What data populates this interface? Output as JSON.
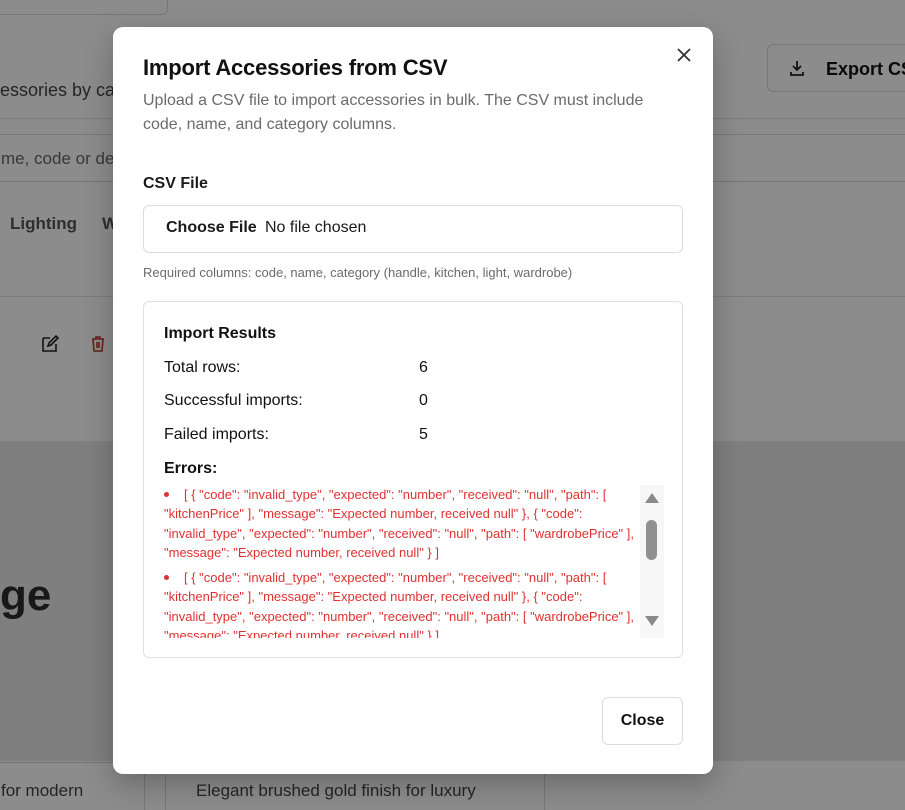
{
  "background": {
    "subtitle": "essories by cate",
    "export_label": "Export CSV",
    "search_placeholder": "me, code or des",
    "tabs": [
      "Lighting",
      "W"
    ],
    "hero_text": "ge",
    "card_left_text": "for modern",
    "card_right_text": "Elegant brushed gold finish for luxury",
    "icons": {
      "edit": "edit-icon",
      "delete": "trash-icon",
      "download": "download-icon"
    }
  },
  "modal": {
    "title": "Import Accessories from CSV",
    "description": "Upload a CSV file to import accessories in bulk. The CSV must include code, name, and category columns.",
    "close_icon": "close-icon",
    "file_field": {
      "label": "CSV File",
      "button_label": "Choose File",
      "status": "No file chosen",
      "hint": "Required columns: code, name, category (handle, kitchen, light, wardrobe)"
    },
    "results": {
      "title": "Import Results",
      "stats": [
        {
          "label": "Total rows:",
          "value": "6"
        },
        {
          "label": "Successful imports:",
          "value": "0"
        },
        {
          "label": "Failed imports:",
          "value": "5"
        }
      ],
      "errors_title": "Errors:",
      "errors": [
        "[ { \"code\": \"invalid_type\", \"expected\": \"number\", \"received\": \"null\", \"path\": [ \"kitchenPrice\" ], \"message\": \"Expected number, received null\" }, { \"code\": \"invalid_type\", \"expected\": \"number\", \"received\": \"null\", \"path\": [ \"wardrobePrice\" ], \"message\": \"Expected number, received null\" } ]",
        "[ { \"code\": \"invalid_type\", \"expected\": \"number\", \"received\": \"null\", \"path\": [ \"kitchenPrice\" ], \"message\": \"Expected number, received null\" }, { \"code\": \"invalid_type\", \"expected\": \"number\", \"received\": \"null\", \"path\": [ \"wardrobePrice\" ], \"message\": \"Expected number, received null\" } ]"
      ]
    },
    "close_button_label": "Close"
  },
  "colors": {
    "error": "#e03131",
    "overlay": "rgba(0,0,0,0.45)",
    "muted_text": "#6b6b6b",
    "border": "#dcdcdc"
  }
}
